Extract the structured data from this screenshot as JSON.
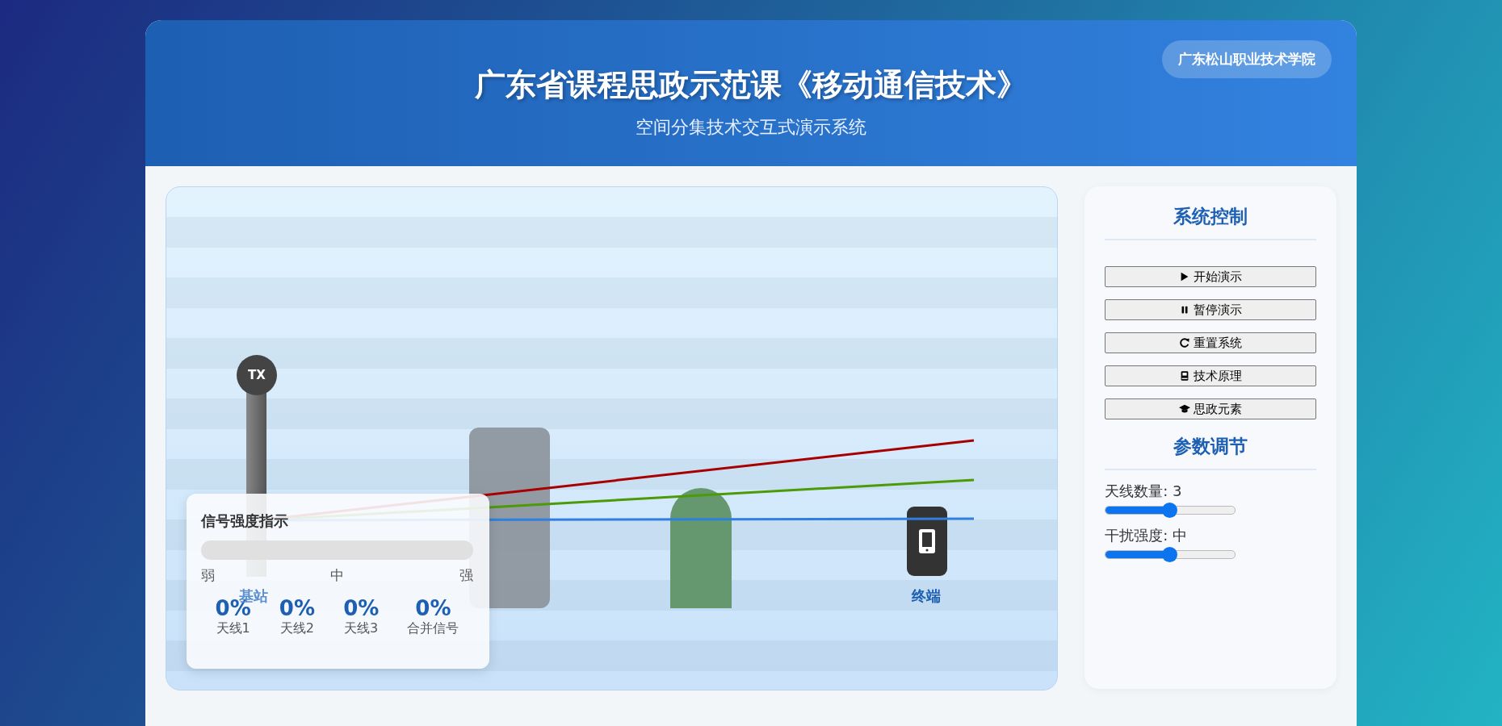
{
  "header": {
    "title": "广东省课程思政示范课《移动通信技术》",
    "subtitle": "空间分集技术交互式演示系统",
    "badge": "广东松山职业技术学院"
  },
  "scene": {
    "tower_label": "TX",
    "station_label": "基站",
    "terminal_label": "终端",
    "beams": [
      {
        "color": "#a80000"
      },
      {
        "color": "#4c9a06"
      },
      {
        "color": "#2f7fe0"
      }
    ],
    "signal_panel": {
      "title": "信号强度指示",
      "level": 0,
      "scale": [
        "弱",
        "中",
        "强"
      ],
      "stats": [
        {
          "value": "0%",
          "label": "天线1"
        },
        {
          "value": "0%",
          "label": "天线2"
        },
        {
          "value": "0%",
          "label": "天线3"
        },
        {
          "value": "0%",
          "label": "合并信号"
        }
      ]
    }
  },
  "controls": {
    "title": "系统控制",
    "buttons": [
      {
        "kind": "play",
        "label": "开始演示"
      },
      {
        "kind": "pause",
        "label": "暂停演示"
      },
      {
        "kind": "reset",
        "label": "重置系统"
      },
      {
        "kind": "book",
        "label": "技术原理"
      },
      {
        "kind": "cap",
        "label": "思政元素"
      }
    ]
  },
  "params": {
    "title": "参数调节",
    "sliders": [
      {
        "label": "天线数量: 3",
        "level": 0.5
      },
      {
        "label": "干扰强度: 中",
        "level": 0.5
      }
    ]
  }
}
